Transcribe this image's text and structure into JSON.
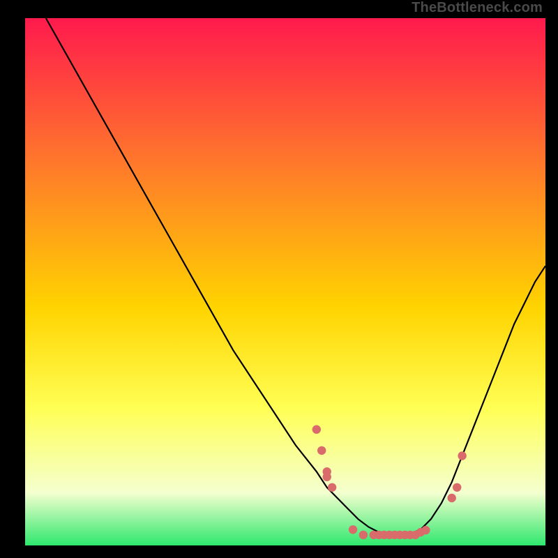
{
  "watermark": "TheBottleneck.com",
  "colors": {
    "gradient_top": "#ff1a4d",
    "gradient_mid1": "#ff7a2a",
    "gradient_mid2": "#ffd400",
    "gradient_mid3": "#ffff55",
    "gradient_bottom1": "#f4ffcf",
    "gradient_bottom2": "#2ee86d",
    "curve": "#000000",
    "point_fill": "#d96b6b",
    "point_stroke": "#d96b6b"
  },
  "chart_data": {
    "type": "line",
    "title": "",
    "xlabel": "",
    "ylabel": "",
    "xlim": [
      0,
      100
    ],
    "ylim": [
      0,
      100
    ],
    "grid": false,
    "legend": false,
    "series": [
      {
        "name": "curve",
        "x": [
          4,
          8,
          12,
          16,
          20,
          24,
          28,
          32,
          36,
          40,
          44,
          48,
          52,
          56,
          58,
          60,
          62,
          64,
          66,
          68,
          70,
          72,
          74,
          76,
          78,
          80,
          82,
          84,
          86,
          88,
          90,
          92,
          94,
          96,
          98,
          100
        ],
        "y": [
          100,
          93,
          86,
          79,
          72,
          65,
          58,
          51,
          44,
          37,
          31,
          25,
          19,
          14,
          11,
          9,
          7,
          5,
          3.5,
          2.5,
          2,
          2,
          2.2,
          3,
          5,
          8,
          12,
          17,
          22,
          27,
          32,
          37,
          42,
          46,
          50,
          53
        ]
      }
    ],
    "points": [
      {
        "x": 56,
        "y": 22
      },
      {
        "x": 57,
        "y": 18
      },
      {
        "x": 58,
        "y": 14
      },
      {
        "x": 58,
        "y": 13
      },
      {
        "x": 59,
        "y": 11
      },
      {
        "x": 63,
        "y": 3
      },
      {
        "x": 65,
        "y": 2
      },
      {
        "x": 67,
        "y": 2
      },
      {
        "x": 68,
        "y": 2
      },
      {
        "x": 69,
        "y": 2
      },
      {
        "x": 70,
        "y": 2
      },
      {
        "x": 71,
        "y": 2
      },
      {
        "x": 72,
        "y": 2
      },
      {
        "x": 73,
        "y": 2
      },
      {
        "x": 74,
        "y": 2
      },
      {
        "x": 75,
        "y": 2
      },
      {
        "x": 76,
        "y": 2.5
      },
      {
        "x": 77,
        "y": 2.9
      },
      {
        "x": 82,
        "y": 9
      },
      {
        "x": 83,
        "y": 11
      },
      {
        "x": 84,
        "y": 17
      }
    ]
  }
}
